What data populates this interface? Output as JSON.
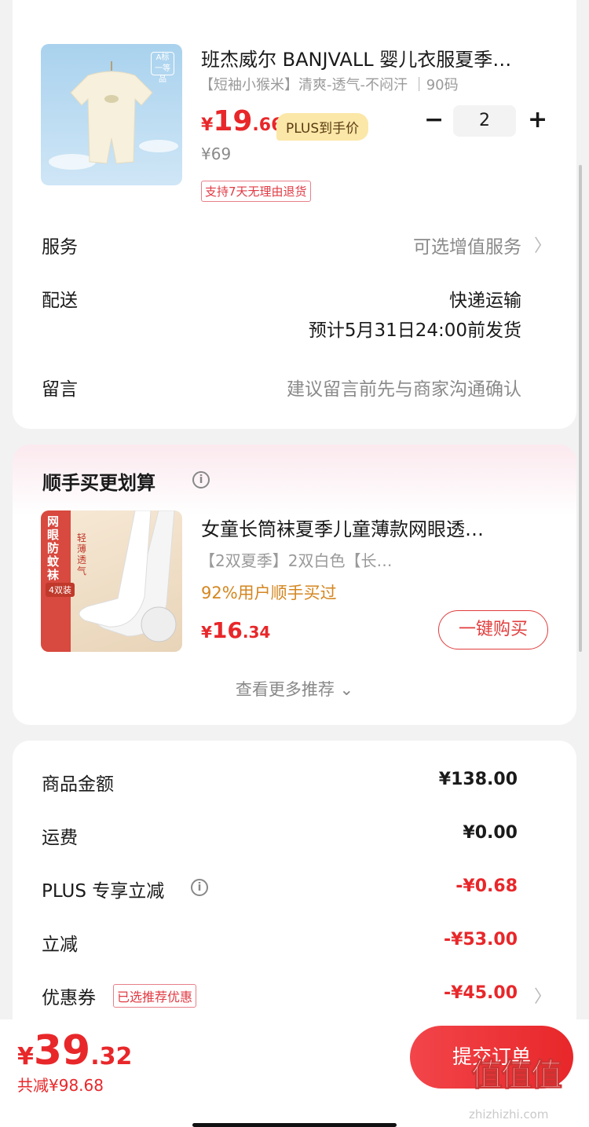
{
  "product": {
    "title": "班杰威尔 BANJVALL 婴儿衣服夏季…",
    "spec": "【短袖小猴米】清爽-透气-不闷汗 ｜90码",
    "price_symbol": "¥",
    "price_int": "19",
    "price_dec": ".66",
    "plus_label": "PLUS到手价",
    "original_price": "¥69",
    "return_policy": "支持7天无理由退货",
    "quantity": "2",
    "minus_label": "−",
    "plus_btn_label": "+",
    "thumb_badge": "A标"
  },
  "service": {
    "label": "服务",
    "value": "可选增值服务"
  },
  "delivery": {
    "label": "配送",
    "method": "快递运输",
    "eta": "预计5月31日24:00前发货"
  },
  "message": {
    "label": "留言",
    "placeholder": "建议留言前先与商家沟通确认"
  },
  "recommend": {
    "title": "顺手买更划算",
    "item": {
      "title": "女童长筒袜夏季儿童薄款网眼透…",
      "spec": "【2双夏季】2双白色【长…",
      "social": "92%用户顺手买过",
      "price_symbol": "¥",
      "price_int": "16",
      "price_dec": ".34",
      "buy_label": "一键购买",
      "thumb_text_1": "网眼防蚊袜",
      "thumb_text_2": "轻薄透气",
      "thumb_text_3": "4双装"
    },
    "more_label": "查看更多推荐"
  },
  "summary": {
    "rows": [
      {
        "label": "商品金额",
        "value": "¥138.00"
      },
      {
        "label": "运费",
        "value": "¥0.00"
      },
      {
        "label": "PLUS 专享立减",
        "value": "-¥0.68"
      },
      {
        "label": "立减",
        "value": "-¥53.00"
      },
      {
        "label": "优惠券",
        "value": "-¥45.00",
        "tag": "已选推荐优惠"
      }
    ]
  },
  "checkout": {
    "total_symbol": "¥",
    "total_int": "39",
    "total_dec": ".32",
    "saved": "共减¥98.68",
    "submit_label": "提交订单"
  },
  "watermark": {
    "logo": "值值值",
    "url": "zhizhizhi.com"
  },
  "colors": {
    "accent_red": "#e8272a",
    "plus_gold": "#fbe7a7"
  }
}
